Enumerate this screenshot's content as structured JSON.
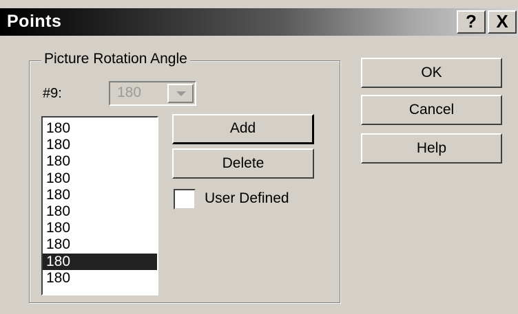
{
  "window": {
    "title": "Points",
    "help_glyph": "?",
    "close_glyph": "X"
  },
  "group": {
    "legend": "Picture Rotation Angle",
    "index_label": "#9:",
    "combo_value": "180",
    "combo_disabled": true
  },
  "list": {
    "items": [
      "180",
      "180",
      "180",
      "180",
      "180",
      "180",
      "180",
      "180",
      "180",
      "180"
    ],
    "selected_index": 8
  },
  "buttons": {
    "add": "Add",
    "delete": "Delete",
    "ok": "OK",
    "cancel": "Cancel",
    "help": "Help"
  },
  "checkbox": {
    "label": "User Defined",
    "checked": false
  },
  "colors": {
    "face": "#d4d0c8",
    "selection": "#222222",
    "disabled_text": "#9a9a9a"
  }
}
